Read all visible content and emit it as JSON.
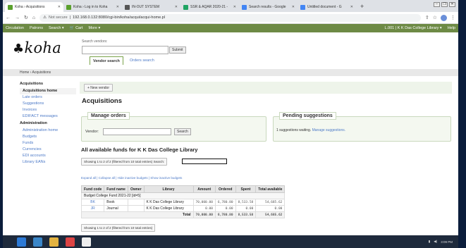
{
  "browser": {
    "tabs": [
      {
        "label": "Koha › Acquisitions",
        "color": "#5aa02c"
      },
      {
        "label": "Koha › Log in to Koha",
        "color": "#5aa02c"
      },
      {
        "label": "IN-OUT SYSTEM",
        "color": "#555555"
      },
      {
        "label": "SSR & AQAR 2020-21 -",
        "color": "#1fa463"
      },
      {
        "label": "Search results - Google",
        "color": "#4285f4"
      },
      {
        "label": "Untitled document - G",
        "color": "#4285f4"
      }
    ],
    "new_tab": "+",
    "address": {
      "security": "Not secure",
      "url": "192.168.0.132:8080/cgi-bin/koha/acqui/acqui-home.pl"
    }
  },
  "topnav": {
    "items": [
      "Circulation",
      "Patrons",
      "Search ▾",
      "Cart",
      "More ▾"
    ],
    "user": "L.001 | K K Das College Library ▾",
    "help": "Help"
  },
  "header": {
    "logo": "koha",
    "vendor_label": "Search vendors:",
    "submit": "Submit",
    "tab_vendor": "Vendor search",
    "tab_orders": "Orders search"
  },
  "breadcrumb": "Home › Acquisitions",
  "sidebar": {
    "sections": [
      {
        "heading": "Acquisitions",
        "items": [
          {
            "label": "Acquisitions home",
            "current": true
          },
          {
            "label": "Late orders"
          },
          {
            "label": "Suggestions"
          },
          {
            "label": "Invoices"
          },
          {
            "label": "EDIFACT messages"
          }
        ]
      },
      {
        "heading": "Administration",
        "items": [
          {
            "label": "Administration home"
          },
          {
            "label": "Budgets"
          },
          {
            "label": "Funds"
          },
          {
            "label": "Currencies"
          },
          {
            "label": "EDI accounts"
          },
          {
            "label": "Library EANs"
          }
        ]
      }
    ]
  },
  "main": {
    "new_vendor": "+ New vendor",
    "title": "Acquisitions",
    "manage_orders": {
      "legend": "Manage orders",
      "vendor_label": "Vendor:",
      "search": "Search"
    },
    "pending": {
      "legend": "Pending suggestions",
      "text": "1 suggestions waiting.",
      "link": "Manage suggestions."
    },
    "funds_title": "All available funds for K K Das College Library",
    "info_top": "Showing 1 to 2 of 2 (filtered from 10 total entries)",
    "search_label": "Search:",
    "links": "Expand all | Collapse all | Hide inactive budgets | Show inactive budgets",
    "table": {
      "headers": [
        "Fund code",
        "Fund name",
        "Owner",
        "Library",
        "Amount",
        "Ordered",
        "Spent",
        "Total available"
      ],
      "group": "Budget College Fund 2021-22 [id=5]",
      "rows": [
        [
          "BK",
          "Book",
          "",
          "K K Das College Library",
          "70,000.00",
          "6,780.80",
          "8,533.58",
          "54,685.62"
        ],
        [
          "JR",
          "Journal",
          "",
          "K K Das College Library",
          "0.00",
          "0.00",
          "0.00",
          "0.00"
        ]
      ],
      "total": [
        "Total",
        "70,000.00",
        "6,780.80",
        "8,533.58",
        "54,685.62"
      ]
    },
    "info_bottom": "Showing 1 to 2 of 2 (filtered from 10 total entries)"
  },
  "taskbar": {
    "clock": "3:09 PM"
  }
}
